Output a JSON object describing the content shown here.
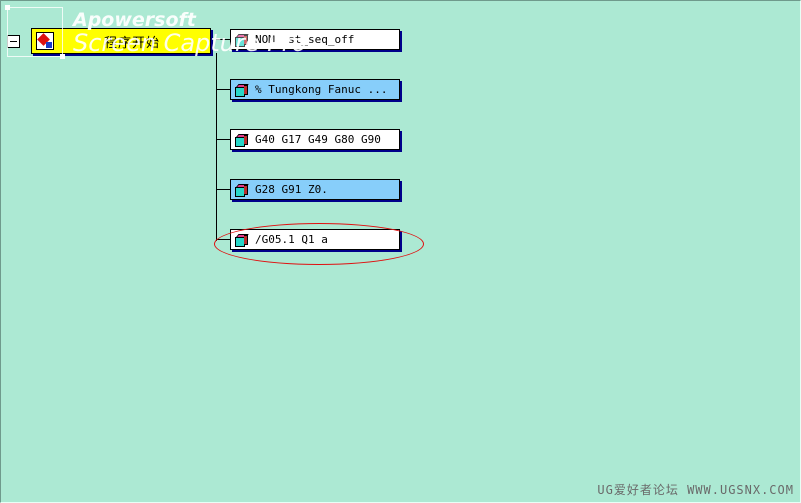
{
  "root": {
    "label": "程序开始"
  },
  "nodes": [
    {
      "label": "NOM  st_seq_off",
      "selected": false
    },
    {
      "label": "% Tungkong Fanuc ...",
      "selected": true
    },
    {
      "label": "G40 G17 G49 G80 G90",
      "selected": false
    },
    {
      "label": "G28 G91 Z0.",
      "selected": true
    },
    {
      "label": "/G05.1 Q1 a",
      "selected": false
    }
  ],
  "watermark": {
    "line1": "Apowersoft",
    "line2": "Screen Capture Pro"
  },
  "footer": {
    "text": "UG爱好者论坛 WWW.UGSNX.COM"
  },
  "colors": {
    "background": "#ace9d3",
    "root_fill": "#ffff00",
    "selected_fill": "#87cefa",
    "node_fill": "#ffffff",
    "annotation": "#e01010"
  }
}
